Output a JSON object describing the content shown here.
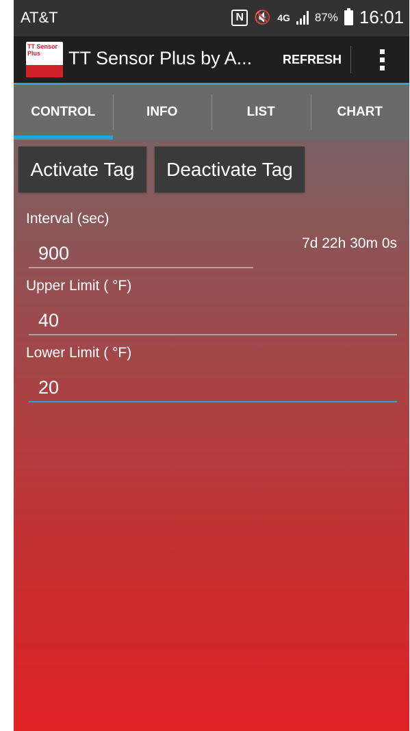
{
  "status_bar": {
    "carrier": "AT&T",
    "nfc_icon": "N",
    "lte_label": "4G",
    "battery": "87%",
    "time": "16:01"
  },
  "action_bar": {
    "title": "TT Sensor Plus by A...",
    "refresh_label": "REFRESH",
    "logo_text": "TT Sensor Plus"
  },
  "tabs": [
    {
      "label": "CONTROL",
      "active": true
    },
    {
      "label": "INFO",
      "active": false
    },
    {
      "label": "LIST",
      "active": false
    },
    {
      "label": "CHART",
      "active": false
    }
  ],
  "control": {
    "activate_label": "Activate Tag",
    "deactivate_label": "Deactivate Tag",
    "interval_label": "Interval (sec)",
    "interval_value": "900",
    "duration": "7d 22h 30m 0s",
    "upper_label": "Upper Limit ( °F)",
    "upper_value": "40",
    "lower_label": "Lower Limit ( °F)",
    "lower_value": "20"
  },
  "colors": {
    "accent": "#2aa5d8",
    "action_bar": "#1f1f1f",
    "gradient_top": "#7a6162",
    "gradient_bottom": "#e02124"
  }
}
